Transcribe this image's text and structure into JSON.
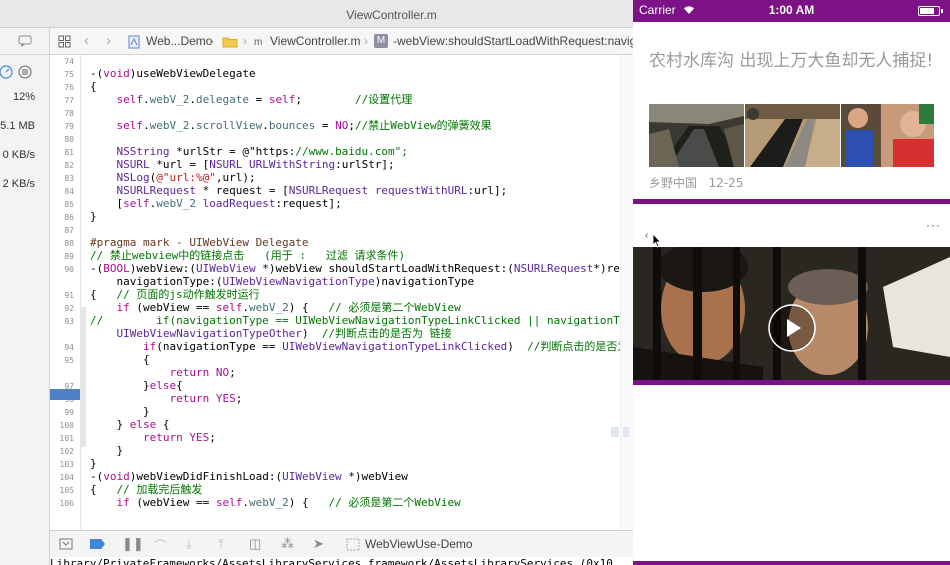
{
  "xcode": {
    "window_title": "ViewController.m",
    "navigator": {
      "cpu": "12%",
      "memory": "5.1 MB",
      "net_in": "0 KB/s",
      "net_out": "2 KB/s"
    },
    "jumpbar": {
      "project": "Web...Demo",
      "file": "ViewController.m",
      "method": "-webView:shouldStartLoadWithRequest:navig"
    },
    "editor": {
      "current_line": "96",
      "lines": [
        {
          "n": "74",
          "t": ""
        },
        {
          "n": "75",
          "t": "-(void)useWebViewDelegate"
        },
        {
          "n": "76",
          "t": "{"
        },
        {
          "n": "77",
          "t": "    self.webV_2.delegate = self;        //设置代理"
        },
        {
          "n": "78",
          "t": ""
        },
        {
          "n": "79",
          "t": "    self.webV_2.scrollView.bounces = NO;//禁止WebView的弹簧效果"
        },
        {
          "n": "80",
          "t": ""
        },
        {
          "n": "81",
          "t": "    NSString *urlStr = @\"https://www.baidu.com\";"
        },
        {
          "n": "82",
          "t": "    NSURL *url = [NSURL URLWithString:urlStr];"
        },
        {
          "n": "83",
          "t": "    NSLog(@\"url:%@\",url);"
        },
        {
          "n": "84",
          "t": "    NSURLRequest * request = [NSURLRequest requestWithURL:url];"
        },
        {
          "n": "85",
          "t": "    [self.webV_2 loadRequest:request];"
        },
        {
          "n": "86",
          "t": "}"
        },
        {
          "n": "87",
          "t": ""
        },
        {
          "n": "88",
          "t": "#pragma mark - UIWebView Delegate"
        },
        {
          "n": "89",
          "t": "// 禁止webview中的链接点击   (用于 :   过滤 请求条件)"
        },
        {
          "n": "90",
          "t": "-(BOOL)webView:(UIWebView *)webView shouldStartLoadWithRequest:(NSURLRequest*)re"
        },
        {
          "n": "",
          "t": "    navigationType:(UIWebViewNavigationType)navigationType"
        },
        {
          "n": "91",
          "t": "{   // 页面的js动作触发时运行"
        },
        {
          "n": "92",
          "t": "    if (webView == self.webV_2) {   // 必须是第二个WebView"
        },
        {
          "n": "93",
          "t": "//        if(navigationType == UIWebViewNavigationTypeLinkClicked || navigationT"
        },
        {
          "n": "",
          "t": "    UIWebViewNavigationTypeOther)  //判断点击的是否为 链接"
        },
        {
          "n": "94",
          "t": "        if(navigationType == UIWebViewNavigationTypeLinkClicked)  //判断点击的是否为"
        },
        {
          "n": "95",
          "t": "        {"
        },
        {
          "n": "96",
          "t": "            return NO;"
        },
        {
          "n": "97",
          "t": "        }else{"
        },
        {
          "n": "98",
          "t": "            return YES;"
        },
        {
          "n": "99",
          "t": "        }"
        },
        {
          "n": "100",
          "t": "    } else {"
        },
        {
          "n": "101",
          "t": "        return YES;"
        },
        {
          "n": "102",
          "t": "    }"
        },
        {
          "n": "103",
          "t": "}"
        },
        {
          "n": "104",
          "t": "-(void)webViewDidFinishLoad:(UIWebView *)webView"
        },
        {
          "n": "105",
          "t": "{   // 加载完后触发"
        },
        {
          "n": "106",
          "t": "    if (webView == self.webV_2) {   // 必须是第二个WebView"
        }
      ]
    },
    "debugbar": {
      "target": "WebViewUse-Demo"
    },
    "console": "Library/PrivateFrameworks/AssetsLibraryServices.framework/AssetsLibraryServices (0x10"
  },
  "simulator": {
    "status": {
      "carrier": "Carrier",
      "time": "1:00 AM"
    },
    "news": {
      "title": "农村水库沟 出现上万大鱼却无人捕捉!",
      "source": "乡野中国",
      "date": "12-25"
    },
    "web": {
      "back": "‹",
      "more": "···"
    },
    "colors": {
      "accent": "#7d1287",
      "breakpoint": "#4f82c4"
    }
  }
}
